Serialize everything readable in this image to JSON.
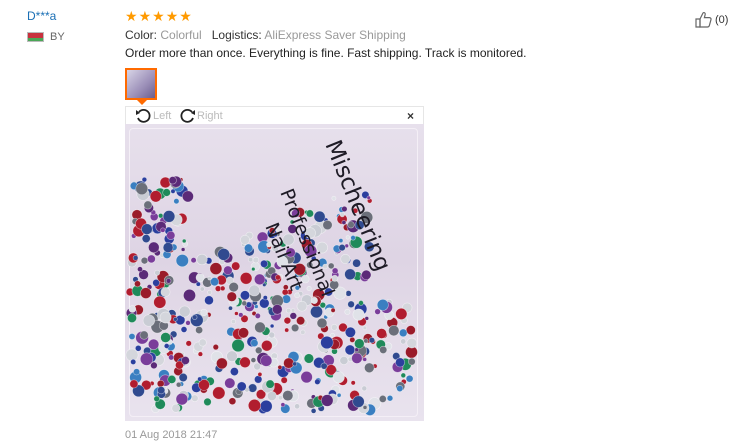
{
  "reviewer": {
    "name": "D***a",
    "country": "BY",
    "flag_colors": [
      "#c8313e",
      "#4aa657"
    ]
  },
  "review": {
    "rating": 5,
    "max_rating": 5,
    "color_label": "Color:",
    "color_value": "Colorful",
    "logistics_label": "Logistics:",
    "logistics_value": "AliExpress Saver Shipping",
    "text": "Order more than once. Everything is fine. Fast shipping. Track is monitored.",
    "date": "01 Aug 2018 21:47"
  },
  "helpful": {
    "count": "(0)",
    "icon": "thumbs-up-icon"
  },
  "viewer": {
    "rotate_left_label": "Left",
    "rotate_right_label": "Right",
    "close_label": "×",
    "bag_text": [
      "Nail Art",
      "Professional",
      "Mischeering"
    ]
  },
  "colors": {
    "star": "#ff9a00",
    "link": "#1a6fb5",
    "thumb_border": "#ff6a00"
  }
}
